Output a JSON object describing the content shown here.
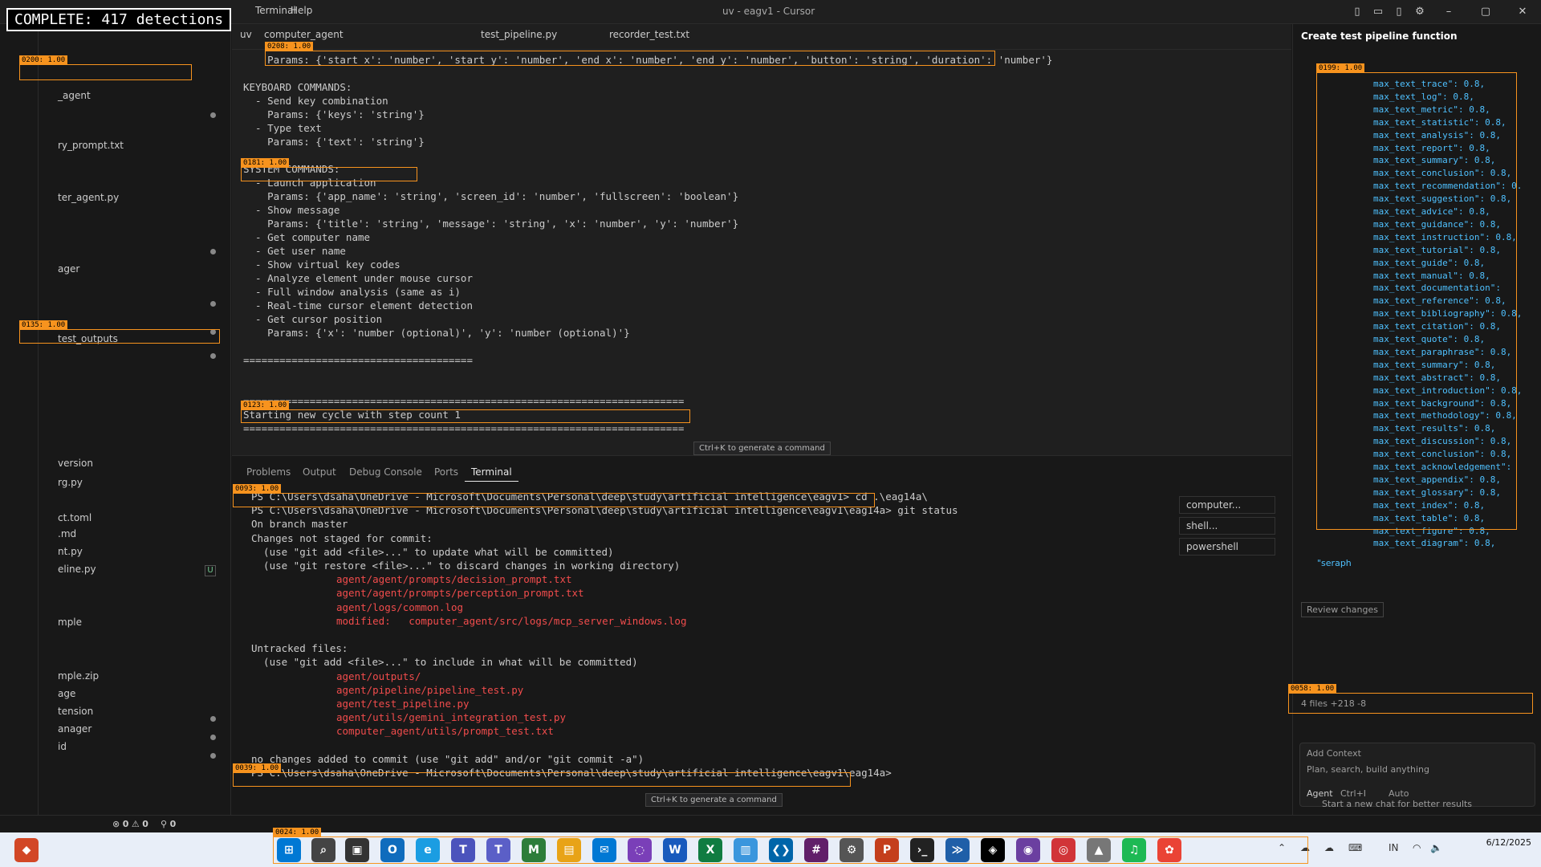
{
  "detection_header": "COMPLETE: 417 detections",
  "titlebar": {
    "menu": [
      "Terminal",
      "Help"
    ],
    "window_title": "uv - eagv1 - Cursor"
  },
  "tabs": [
    "uv",
    "computer_agent",
    "test_pipeline.py",
    "recorder_test.txt"
  ],
  "explorer": {
    "rows": [
      "_agent",
      "ry_prompt.txt",
      "ter_agent.py",
      "ager",
      "test_outputs",
      "version",
      "rg.py",
      "ct.toml",
      ".md",
      "nt.py",
      "eline.py",
      "mple",
      "mple.zip",
      "age",
      "tension",
      "anager",
      "id"
    ]
  },
  "editor": {
    "lines": [
      "    Params: {'start_x': 'number', 'start_y': 'number', 'end_x': 'number', 'end_y': 'number', 'button': 'string', 'duration': 'number'}",
      "",
      "KEYBOARD COMMANDS:",
      "  - Send key combination",
      "    Params: {'keys': 'string'}",
      "  - Type text",
      "    Params: {'text': 'string'}",
      "",
      "SYSTEM COMMANDS:",
      "  - Launch application",
      "    Params: {'app_name': 'string', 'screen_id': 'number', 'fullscreen': 'boolean'}",
      "  - Show message",
      "    Params: {'title': 'string', 'message': 'string', 'x': 'number', 'y': 'number'}",
      "  - Get computer name",
      "  - Get user name",
      "  - Show virtual key codes",
      "  - Analyze element under mouse cursor",
      "  - Full window analysis (same as i)",
      "  - Real-time cursor element detection",
      "  - Get cursor position",
      "    Params: {'x': 'number (optional)', 'y': 'number (optional)'}",
      "",
      "======================================",
      "",
      "",
      "=========================================================================",
      "Starting new cycle with step count 1",
      "========================================================================="
    ],
    "ctrlk_hint": "Ctrl+K to generate a command"
  },
  "panel": {
    "tabs": [
      "Problems",
      "Output",
      "Debug Console",
      "Ports",
      "Terminal"
    ],
    "active_tab": "Terminal",
    "terminal_lines": [
      {
        "text": "PS C:\\Users\\dsaha\\OneDrive - Microsoft\\Documents\\Personal\\deep\\study\\artificial intelligence\\eagv1> cd .\\eag14a\\",
        "cls": ""
      },
      {
        "text": "PS C:\\Users\\dsaha\\OneDrive - Microsoft\\Documents\\Personal\\deep\\study\\artificial intelligence\\eagv1\\eag14a> git status",
        "cls": ""
      },
      {
        "text": "On branch master",
        "cls": ""
      },
      {
        "text": "Changes not staged for commit:",
        "cls": ""
      },
      {
        "text": "  (use \"git add <file>...\" to update what will be committed)",
        "cls": ""
      },
      {
        "text": "  (use \"git restore <file>...\" to discard changes in working directory)",
        "cls": ""
      },
      {
        "text": "agent/agent/prompts/decision_prompt.txt",
        "cls": "red"
      },
      {
        "text": "agent/agent/prompts/perception_prompt.txt",
        "cls": "red"
      },
      {
        "text": "agent/logs/common.log",
        "cls": "red"
      },
      {
        "text": "modified:   computer_agent/src/logs/mcp_server_windows.log",
        "cls": "red"
      },
      {
        "text": "",
        "cls": ""
      },
      {
        "text": "Untracked files:",
        "cls": ""
      },
      {
        "text": "  (use \"git add <file>...\" to include in what will be committed)",
        "cls": ""
      },
      {
        "text": "agent/outputs/",
        "cls": "red"
      },
      {
        "text": "agent/pipeline/pipeline_test.py",
        "cls": "red"
      },
      {
        "text": "agent/test_pipeline.py",
        "cls": "red"
      },
      {
        "text": "agent/utils/gemini_integration_test.py",
        "cls": "red"
      },
      {
        "text": "computer_agent/utils/prompt_test.txt",
        "cls": "red"
      },
      {
        "text": "",
        "cls": ""
      },
      {
        "text": "no changes added to commit (use \"git add\" and/or \"git commit -a\")",
        "cls": ""
      },
      {
        "text": "PS C:\\Users\\dsaha\\OneDrive - Microsoft\\Documents\\Personal\\deep\\study\\artificial intelligence\\eagv1\\eag14a> ",
        "cls": ""
      }
    ],
    "terminal_hint": "Ctrl+K to generate a command",
    "terminal_list": [
      "computer...",
      "shell...",
      "powershell"
    ]
  },
  "chat": {
    "title": "Create test pipeline function",
    "code_lines": [
      "max_text_trace\": 0.8,",
      "max_text_log\": 0.8,",
      "max_text_metric\": 0.8,",
      "max_text_statistic\": 0.8,",
      "max_text_analysis\": 0.8,",
      "max_text_report\": 0.8,",
      "max_text_summary\": 0.8,",
      "max_text_conclusion\": 0.8,",
      "max_text_recommendation\": 0.",
      "max_text_suggestion\": 0.8,",
      "max_text_advice\": 0.8,",
      "max_text_guidance\": 0.8,",
      "max_text_instruction\": 0.8,",
      "max_text_tutorial\": 0.8,",
      "max_text_guide\": 0.8,",
      "max_text_manual\": 0.8,",
      "max_text_documentation\":",
      "max_text_reference\": 0.8,",
      "max_text_bibliography\": 0.8,",
      "max_text_citation\": 0.8,",
      "max_text_quote\": 0.8,",
      "max_text_paraphrase\": 0.8,",
      "max_text_summary\": 0.8,",
      "max_text_abstract\": 0.8,",
      "max_text_introduction\": 0.8,",
      "max_text_background\": 0.8,",
      "max_text_methodology\": 0.8,",
      "max_text_results\": 0.8,",
      "max_text_discussion\": 0.8,",
      "max_text_conclusion\": 0.8,",
      "max_text_acknowledgement\":",
      "max_text_appendix\": 0.8,",
      "max_text_glossary\": 0.8,",
      "max_text_index\": 0.8,",
      "max_text_table\": 0.8,",
      "max_text_figure\": 0.8,",
      "max_text_diagram\": 0.8,"
    ],
    "closing": "\"seraph",
    "review_changes": "Review changes",
    "files_summary": "4 files +218 -8",
    "add_context": "Add Context",
    "placeholder": "Plan, search, build anything",
    "agent_label": "Agent",
    "agent_shortcut": "Ctrl+I",
    "auto_label": "Auto",
    "new_chat_hint": "Start a new chat for better results"
  },
  "statusbar": {
    "errors": "0",
    "warnings": "0",
    "ports": "0"
  },
  "taskbar": {
    "time": "",
    "date": "6/12/2025",
    "lang": "IN"
  },
  "colors": {
    "editor_bg": "#1f1f1f",
    "side_bg": "#181818",
    "detection": "#f7931e",
    "term_red": "#f14c4c"
  }
}
